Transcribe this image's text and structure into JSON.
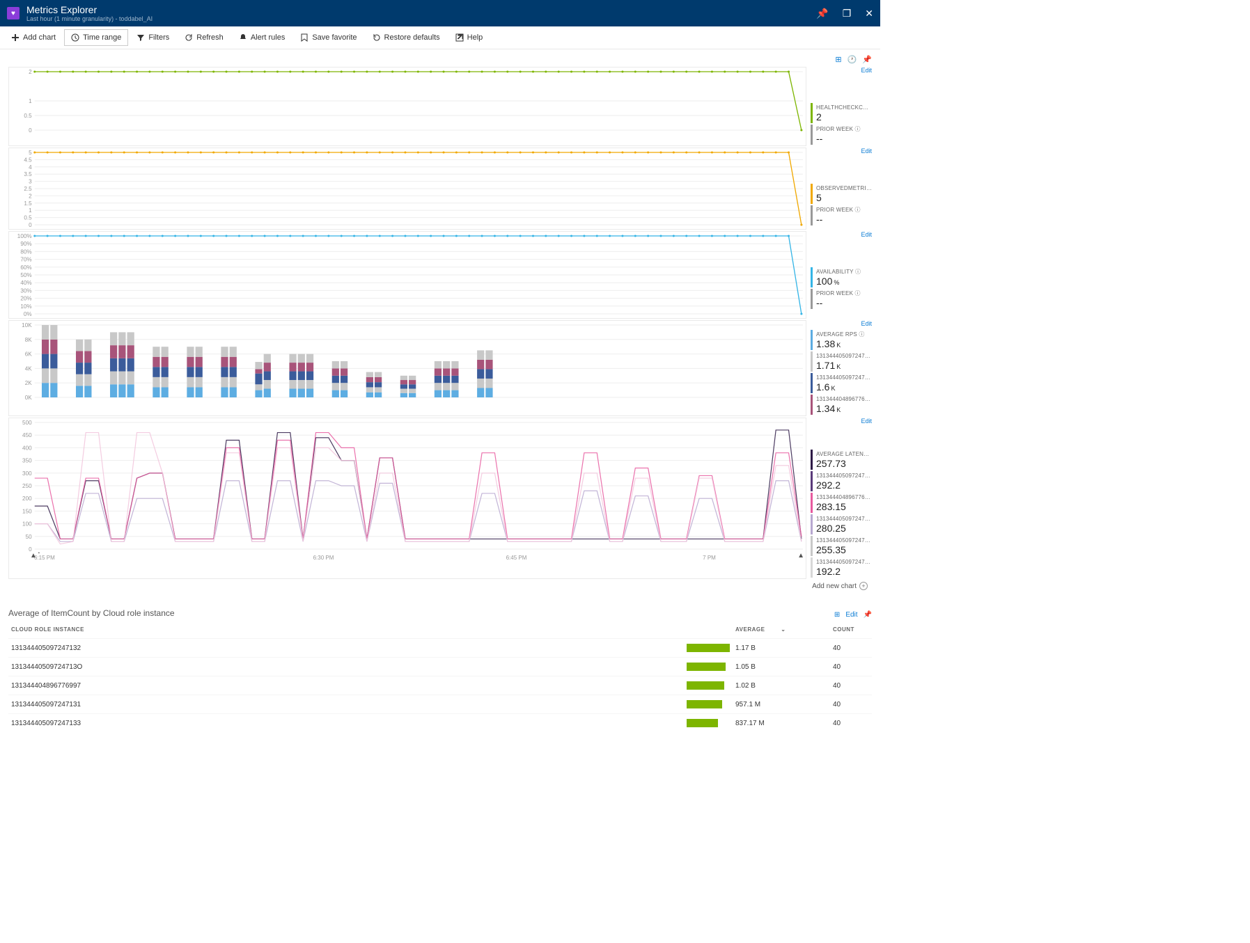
{
  "header": {
    "title": "Metrics Explorer",
    "subtitle": "Last hour (1 minute granularity) - toddabel_AI"
  },
  "winbtns": {
    "pin": "📌",
    "max": "❐",
    "close": "✕"
  },
  "toolbar": {
    "add": "Add chart",
    "time": "Time range",
    "filters": "Filters",
    "refresh": "Refresh",
    "alert": "Alert rules",
    "fav": "Save favorite",
    "restore": "Restore defaults",
    "help": "Help"
  },
  "actions": {
    "edit": "Edit"
  },
  "xticks": [
    "6:15 PM",
    "6:30 PM",
    "6:45 PM",
    "7 PM"
  ],
  "add_new_chart": "Add new chart",
  "chart_data": [
    {
      "id": "health",
      "type": "line",
      "yticks": [
        0,
        0.5,
        1,
        2
      ],
      "color": "#7db500",
      "points": [
        2,
        2,
        2,
        2,
        2,
        2,
        2,
        2,
        2,
        2,
        2,
        2,
        2,
        2,
        2,
        2,
        2,
        2,
        2,
        2,
        2,
        2,
        2,
        2,
        2,
        2,
        2,
        2,
        2,
        2,
        2,
        2,
        2,
        2,
        2,
        2,
        2,
        2,
        2,
        2,
        2,
        2,
        2,
        2,
        2,
        2,
        2,
        2,
        2,
        2,
        2,
        2,
        2,
        2,
        2,
        2,
        2,
        2,
        2,
        2,
        0
      ],
      "legend": [
        {
          "lbl": "HEALTHCHECKCOUNT",
          "val": "2",
          "unit": "",
          "c": "#7db500"
        },
        {
          "lbl": "PRIOR WEEK",
          "val": "--",
          "c": "#999"
        }
      ]
    },
    {
      "id": "observed",
      "type": "line",
      "yticks": [
        0,
        0.5,
        1,
        1.5,
        2,
        2.5,
        3,
        3.5,
        4,
        4.5,
        5
      ],
      "color": "#f0a800",
      "points": [
        5,
        5,
        5,
        5,
        5,
        5,
        5,
        5,
        5,
        5,
        5,
        5,
        5,
        5,
        5,
        5,
        5,
        5,
        5,
        5,
        5,
        5,
        5,
        5,
        5,
        5,
        5,
        5,
        5,
        5,
        5,
        5,
        5,
        5,
        5,
        5,
        5,
        5,
        5,
        5,
        5,
        5,
        5,
        5,
        5,
        5,
        5,
        5,
        5,
        5,
        5,
        5,
        5,
        5,
        5,
        5,
        5,
        5,
        5,
        5,
        0
      ],
      "legend": [
        {
          "lbl": "OBSERVEDMETRICCO...",
          "val": "5",
          "unit": "",
          "c": "#f0a800"
        },
        {
          "lbl": "PRIOR WEEK",
          "val": "--",
          "c": "#999"
        }
      ]
    },
    {
      "id": "avail",
      "type": "line",
      "yticks": [
        0,
        10,
        20,
        30,
        40,
        50,
        60,
        70,
        80,
        90,
        100
      ],
      "ysuffix": "%",
      "color": "#35b5e6",
      "points": [
        100,
        100,
        100,
        100,
        100,
        100,
        100,
        100,
        100,
        100,
        100,
        100,
        100,
        100,
        100,
        100,
        100,
        100,
        100,
        100,
        100,
        100,
        100,
        100,
        100,
        100,
        100,
        100,
        100,
        100,
        100,
        100,
        100,
        100,
        100,
        100,
        100,
        100,
        100,
        100,
        100,
        100,
        100,
        100,
        100,
        100,
        100,
        100,
        100,
        100,
        100,
        100,
        100,
        100,
        100,
        100,
        100,
        100,
        100,
        100,
        0
      ],
      "legend": [
        {
          "lbl": "AVAILABILITY",
          "val": "100",
          "unit": "%",
          "c": "#35b5e6"
        },
        {
          "lbl": "PRIOR WEEK",
          "val": "--",
          "c": "#999"
        }
      ]
    },
    {
      "id": "rps",
      "type": "bar",
      "yticks": [
        0,
        2,
        4,
        6,
        8,
        10
      ],
      "ysuffix": "K",
      "segcolors": [
        "#5dade2",
        "#c8c8c8",
        "#3b5c9b",
        "#a8547a",
        "#c8c8c8"
      ],
      "groups": [
        {
          "g": [
            [
              2,
              2,
              2,
              2,
              2
            ],
            [
              2,
              2,
              2,
              2,
              2
            ]
          ],
          "gap": 1
        },
        {
          "g": [
            [
              1.6,
              1.6,
              1.6,
              1.6,
              1.6
            ],
            [
              1.6,
              1.6,
              1.6,
              1.6,
              1.6
            ]
          ],
          "gap": 1
        },
        {
          "g": [
            [
              1.8,
              1.8,
              1.8,
              1.8,
              1.8
            ],
            [
              1.8,
              1.8,
              1.8,
              1.8,
              1.8
            ],
            [
              1.8,
              1.8,
              1.8,
              1.8,
              1.8
            ]
          ],
          "gap": 1
        },
        {
          "g": [
            [
              1.4,
              1.4,
              1.4,
              1.4,
              1.4
            ],
            [
              1.4,
              1.4,
              1.4,
              1.4,
              1.4
            ]
          ],
          "gap": 1
        },
        {
          "g": [
            [
              1.4,
              1.4,
              1.4,
              1.4,
              1.4
            ],
            [
              1.4,
              1.4,
              1.4,
              1.4,
              1.4
            ]
          ],
          "gap": 1
        },
        {
          "g": [
            [
              1.4,
              1.4,
              1.4,
              1.4,
              1.4
            ],
            [
              1.4,
              1.4,
              1.4,
              1.4,
              1.4
            ]
          ],
          "gap": 1
        },
        {
          "g": [
            [
              1.0,
              0.8,
              1.5,
              0.6,
              1.0
            ],
            [
              1.2,
              1.2,
              1.2,
              1.2,
              1.2
            ]
          ],
          "gap": 1
        },
        {
          "g": [
            [
              1.2,
              1.2,
              1.2,
              1.2,
              1.2
            ],
            [
              1.2,
              1.2,
              1.2,
              1.2,
              1.2
            ],
            [
              1.2,
              1.2,
              1.2,
              1.2,
              1.2
            ]
          ],
          "gap": 1
        },
        {
          "g": [
            [
              1.0,
              1.0,
              1.0,
              1.0,
              1.0
            ],
            [
              1.0,
              1.0,
              1.0,
              1.0,
              1.0
            ]
          ],
          "gap": 1
        },
        {
          "g": [
            [
              0.7,
              0.7,
              0.7,
              0.7,
              0.7
            ],
            [
              0.7,
              0.7,
              0.7,
              0.7,
              0.7
            ]
          ],
          "gap": 1
        },
        {
          "g": [
            [
              0.6,
              0.6,
              0.6,
              0.6,
              0.6
            ],
            [
              0.6,
              0.6,
              0.6,
              0.6,
              0.6
            ]
          ],
          "gap": 1
        },
        {
          "g": [
            [
              1.0,
              1.0,
              1.0,
              1.0,
              1.0
            ],
            [
              1.0,
              1.0,
              1.0,
              1.0,
              1.0
            ],
            [
              1.0,
              1.0,
              1.0,
              1.0,
              1.0
            ]
          ],
          "gap": 1
        },
        {
          "g": [
            [
              1.3,
              1.3,
              1.3,
              1.3,
              1.3
            ],
            [
              1.3,
              1.3,
              1.3,
              1.3,
              1.3
            ]
          ],
          "gap": 1
        }
      ],
      "legend": [
        {
          "lbl": "AVERAGE RPS",
          "val": "1.38",
          "unit": "K",
          "c": "#5dade2"
        },
        {
          "lbl": "13134440509724713O",
          "val": "1.71",
          "unit": "K",
          "c": "#c8c8c8"
        },
        {
          "lbl": "131344405097247132",
          "val": "1.6",
          "unit": "K",
          "c": "#3b5c9b"
        },
        {
          "lbl": "131344404896776997",
          "val": "1.34",
          "unit": "K",
          "c": "#a8547a"
        }
      ]
    },
    {
      "id": "latency",
      "type": "line",
      "yticks": [
        0,
        50,
        100,
        150,
        200,
        250,
        300,
        350,
        400,
        450,
        500
      ],
      "xticks_global": true,
      "series": [
        {
          "c": "#2e1a47",
          "pts": [
            170,
            170,
            40,
            40,
            270,
            270,
            40,
            40,
            280,
            300,
            300,
            40,
            40,
            40,
            40,
            430,
            430,
            40,
            40,
            460,
            460,
            40,
            440,
            440,
            350,
            350,
            40,
            360,
            360,
            40,
            40,
            40,
            40,
            40,
            40,
            40,
            40,
            40,
            40,
            40,
            40,
            40,
            40,
            40,
            40,
            40,
            40,
            40,
            40,
            40,
            40,
            40,
            40,
            40,
            40,
            40,
            40,
            40,
            470,
            470,
            40
          ]
        },
        {
          "c": "#e75a9f",
          "pts": [
            280,
            280,
            40,
            40,
            280,
            280,
            40,
            40,
            280,
            300,
            300,
            40,
            40,
            40,
            40,
            400,
            400,
            40,
            40,
            430,
            430,
            40,
            460,
            460,
            400,
            400,
            40,
            360,
            360,
            40,
            40,
            40,
            40,
            40,
            40,
            380,
            380,
            40,
            40,
            40,
            40,
            40,
            40,
            380,
            380,
            40,
            40,
            320,
            320,
            40,
            40,
            40,
            290,
            290,
            40,
            40,
            40,
            40,
            380,
            380,
            50
          ]
        },
        {
          "c": "#b8a8d0",
          "pts": [
            100,
            100,
            30,
            30,
            220,
            220,
            30,
            30,
            200,
            200,
            200,
            30,
            30,
            30,
            30,
            270,
            270,
            30,
            30,
            270,
            270,
            30,
            270,
            270,
            250,
            250,
            30,
            260,
            260,
            30,
            30,
            30,
            30,
            30,
            30,
            220,
            220,
            30,
            30,
            30,
            30,
            30,
            30,
            230,
            230,
            30,
            30,
            210,
            210,
            30,
            30,
            30,
            200,
            200,
            30,
            30,
            30,
            30,
            270,
            270,
            30
          ]
        },
        {
          "c": "#f2c4dc",
          "pts": [
            100,
            100,
            20,
            30,
            460,
            460,
            30,
            30,
            460,
            460,
            300,
            30,
            30,
            30,
            30,
            380,
            380,
            30,
            30,
            400,
            400,
            30,
            400,
            400,
            350,
            350,
            30,
            300,
            300,
            30,
            30,
            30,
            30,
            30,
            30,
            300,
            300,
            30,
            30,
            30,
            30,
            30,
            30,
            300,
            300,
            30,
            30,
            280,
            280,
            30,
            30,
            30,
            280,
            280,
            30,
            30,
            30,
            30,
            330,
            330,
            30
          ]
        }
      ],
      "legend": [
        {
          "lbl": "AVERAGE LATENCY",
          "val": "257.73",
          "c": "#2e1a47"
        },
        {
          "lbl": "131344405097247131",
          "val": "292.2",
          "c": "#5a3a7a"
        },
        {
          "lbl": "131344404896776997",
          "val": "283.15",
          "c": "#e75a9f"
        },
        {
          "lbl": "13134440509724713O",
          "val": "280.25",
          "c": "#b8a8d0"
        },
        {
          "lbl": "131344405097247132",
          "val": "255.35",
          "c": "#c8c8c8"
        },
        {
          "lbl": "131344405097247133",
          "val": "192.2",
          "c": "#d8d8d8"
        }
      ]
    }
  ],
  "table": {
    "title": "Average of ItemCount by Cloud role instance",
    "cols": {
      "inst": "CLOUD ROLE INSTANCE",
      "avg": "AVERAGE",
      "cnt": "COUNT"
    },
    "rows": [
      {
        "inst": "131344405097247132",
        "avg": "1.17 B",
        "cnt": "40",
        "bar": 100
      },
      {
        "inst": "13134440509724713O",
        "avg": "1.05 B",
        "cnt": "40",
        "bar": 90
      },
      {
        "inst": "131344404896776997",
        "avg": "1.02 B",
        "cnt": "40",
        "bar": 87
      },
      {
        "inst": "131344405097247131",
        "avg": "957.1 M",
        "cnt": "40",
        "bar": 82
      },
      {
        "inst": "131344405097247133",
        "avg": "837.17 M",
        "cnt": "40",
        "bar": 72
      }
    ]
  }
}
